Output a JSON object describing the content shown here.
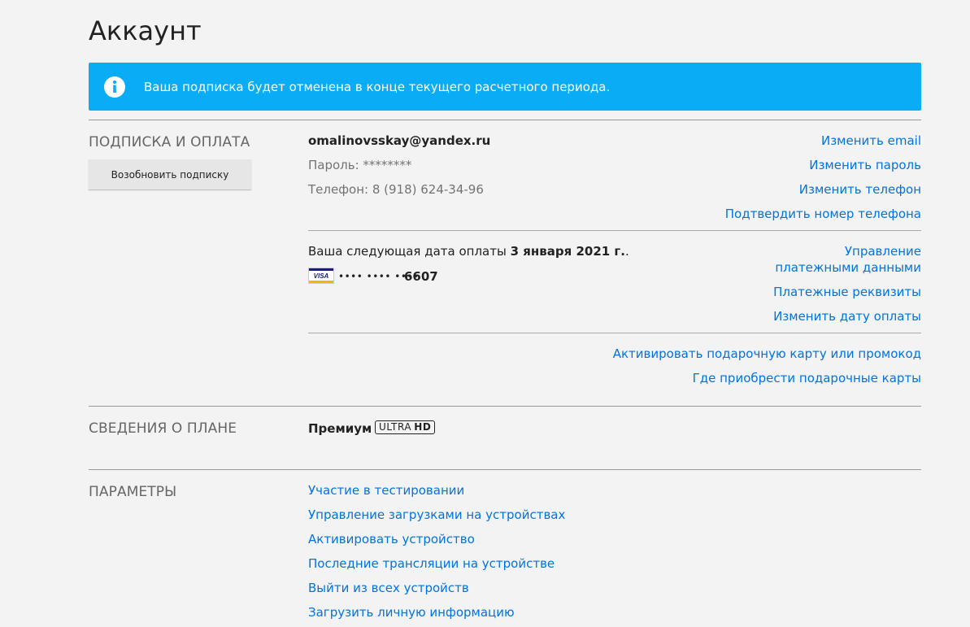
{
  "page": {
    "title": "Аккаунт"
  },
  "banner": {
    "icon": "info-icon",
    "text": "Ваша подписка будет отменена в конце текущего расчетного периода.",
    "color": "#0aadf5"
  },
  "subscription": {
    "section_title": "ПОДПИСКА И ОПЛАТА",
    "resume_button": "Возобновить подписку",
    "email": "omalinovsskay@yandex.ru",
    "password": "Пароль: ********",
    "phone": "Телефон: 8 (918) 624-34-96",
    "links": {
      "change_email": "Изменить email",
      "change_password": "Изменить пароль",
      "change_phone": "Изменить телефон",
      "confirm_phone": "Подтвердить номер телефона"
    },
    "billing": {
      "next_date_prefix": "Ваша следующая дата оплаты ",
      "next_date": "3 января 2021 г.",
      "next_date_suffix": ".",
      "card_brand": "VISA",
      "card_mask": "•••• •••• ••••",
      "card_last4": "6607",
      "links": {
        "manage_payment": "Управление платежными данными",
        "payment_details": "Платежные реквизиты",
        "change_billing_date": "Изменить дату оплаты"
      }
    },
    "gift": {
      "activate": "Активировать подарочную карту или промокод",
      "where_to_buy": "Где приобрести подарочные карты"
    }
  },
  "plan": {
    "section_title": "СВЕДЕНИЯ О ПЛАНЕ",
    "name": "Премиум",
    "badge_ultra": "ULTRA",
    "badge_hd": "HD"
  },
  "settings": {
    "section_title": "ПАРАМЕТРЫ",
    "links": [
      "Участие в тестировании",
      "Управление загрузками на устройствах",
      "Активировать устройство",
      "Последние трансляции на устройстве",
      "Выйти из всех устройств",
      "Загрузить личную информацию"
    ]
  },
  "colors": {
    "link": "#0073e6",
    "banner": "#0aadf5",
    "background": "#f3f3f3"
  }
}
